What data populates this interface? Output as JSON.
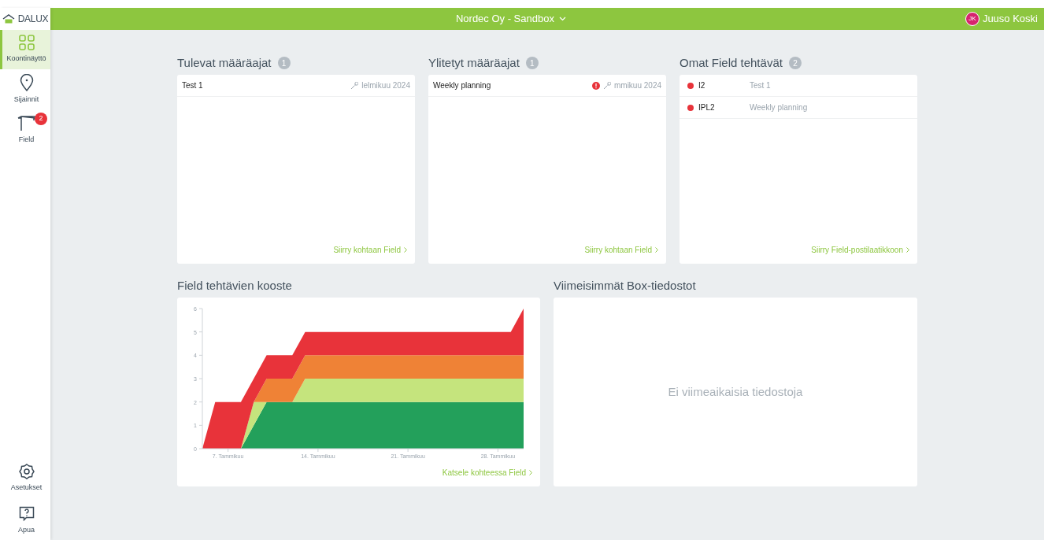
{
  "logo": {
    "text": "DALUX"
  },
  "topbar": {
    "title": "Nordec Oy - Sandbox",
    "user": {
      "initials": "JK",
      "name": "Juuso Koski"
    }
  },
  "sidebar": {
    "items": [
      {
        "kind": "grid",
        "label": "Koontinäyttö",
        "selected": true
      },
      {
        "kind": "pin",
        "label": "Sijainnit",
        "selected": false
      },
      {
        "kind": "crane",
        "label": "Field",
        "selected": false,
        "badge": "2"
      }
    ],
    "bottom_items": [
      {
        "kind": "gear",
        "label": "Asetukset",
        "selected": false
      },
      {
        "kind": "help",
        "label": "Apua",
        "selected": false
      }
    ]
  },
  "panels": [
    {
      "title": "Tulevat määräajat",
      "count": "1",
      "rows": [
        {
          "name": "Test 1",
          "overdue": false,
          "date": "lelmikuu 2024"
        }
      ],
      "link": "Siirry kohtaan Field"
    },
    {
      "title": "Ylitetyt määräajat",
      "count": "1",
      "rows": [
        {
          "name": "Weekly planning",
          "overdue": true,
          "date": "mmikuu 2024"
        }
      ],
      "link": "Siirry kohtaan Field"
    },
    {
      "title": "Omat Field tehtävät",
      "count": "2",
      "tasks": [
        {
          "code": "I2",
          "name": "Test 1",
          "color": "#e8333a"
        },
        {
          "code": "IPL2",
          "name": "Weekly planning",
          "color": "#e8333a"
        }
      ],
      "link": "Siirry Field-postilaatikkoon"
    }
  ],
  "summary": {
    "title": "Field tehtävien kooste",
    "link": "Katsele kohteessa Field",
    "chart_data": {
      "type": "area",
      "stacked": true,
      "x": [
        5,
        6,
        7,
        8,
        9,
        10,
        11,
        12,
        13,
        14,
        15,
        16,
        17,
        18,
        19,
        20,
        21,
        22,
        23,
        24,
        25,
        26,
        27,
        28,
        29,
        30
      ],
      "xlim": [
        5,
        30
      ],
      "ylim": [
        0,
        6
      ],
      "xticks": [
        {
          "value": 7,
          "label": "7. Tammikuu"
        },
        {
          "value": 14,
          "label": "14. Tammikuu"
        },
        {
          "value": 21,
          "label": "21. Tammikuu"
        },
        {
          "value": 28,
          "label": "28. Tammikuu"
        }
      ],
      "yticks": [
        0,
        1,
        2,
        3,
        4,
        5,
        6
      ],
      "series": [
        {
          "color": "#23a05b",
          "values": [
            0,
            0,
            0,
            0,
            1,
            2,
            2,
            2,
            2,
            2,
            2,
            2,
            2,
            2,
            2,
            2,
            2,
            2,
            2,
            2,
            2,
            2,
            2,
            2,
            2,
            2
          ]
        },
        {
          "color": "#c5e47d",
          "values": [
            0,
            0,
            0,
            0,
            1,
            0,
            0,
            0,
            1,
            1,
            1,
            1,
            1,
            1,
            1,
            1,
            1,
            1,
            1,
            1,
            1,
            1,
            1,
            1,
            1,
            1
          ]
        },
        {
          "color": "#ef8236",
          "values": [
            0,
            0,
            0,
            0,
            0,
            1,
            1,
            1,
            1,
            1,
            1,
            1,
            1,
            1,
            1,
            1,
            1,
            1,
            1,
            1,
            1,
            1,
            1,
            1,
            1,
            1
          ]
        },
        {
          "color": "#e8333a",
          "values": [
            0,
            2,
            2,
            2,
            1,
            1,
            1,
            1,
            1,
            1,
            1,
            1,
            1,
            1,
            1,
            1,
            1,
            1,
            1,
            1,
            1,
            1,
            1,
            1,
            1,
            2
          ]
        }
      ]
    }
  },
  "files": {
    "title": "Viimeisimmät Box-tiedostot",
    "empty_text": "Ei viimeaikaisia tiedostoja"
  }
}
